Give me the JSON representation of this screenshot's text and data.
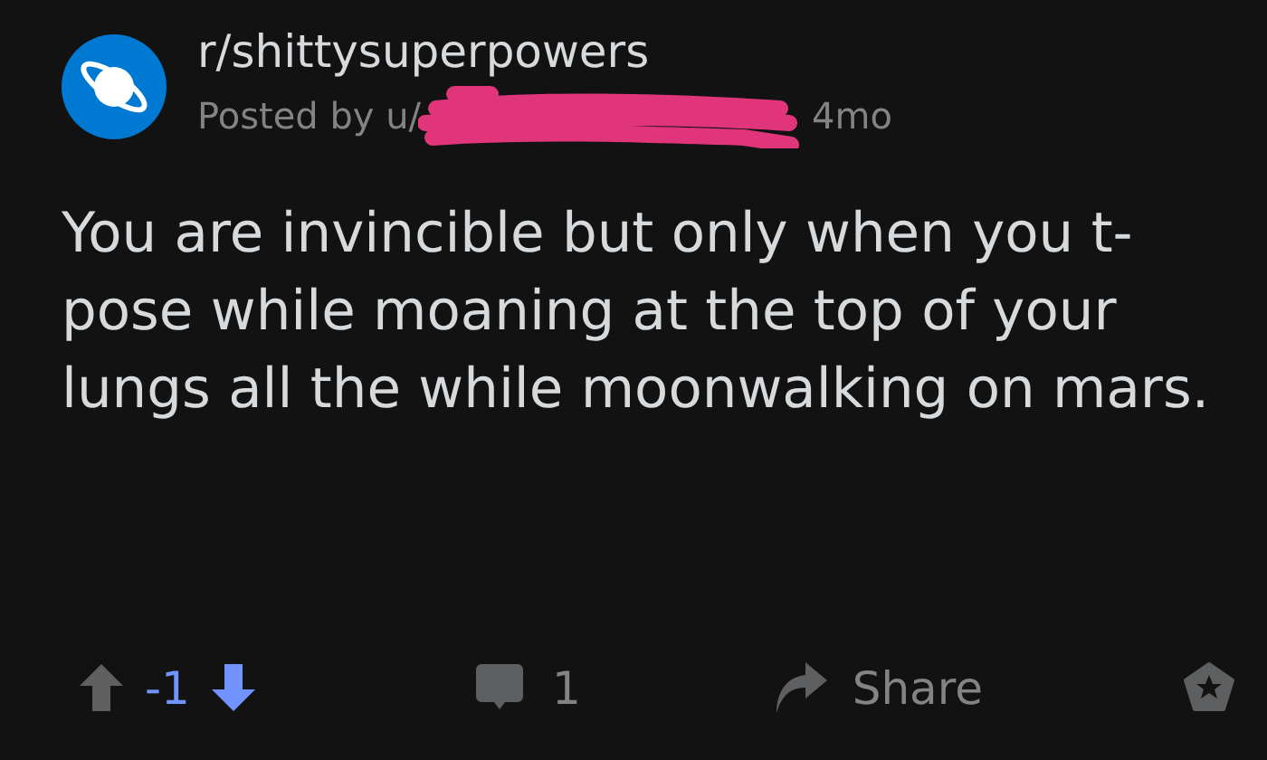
{
  "post": {
    "subreddit": "r/shittysuperpowers",
    "byline": "Posted by u/",
    "age": "4mo",
    "redacted": true,
    "title": "You are invincible but only when you t-pose while moaning at the top of your lungs all the while moonwalking on mars."
  },
  "actions": {
    "score": "-1",
    "upvoted": false,
    "downvoted": true,
    "comments": "1",
    "share": "Share"
  }
}
